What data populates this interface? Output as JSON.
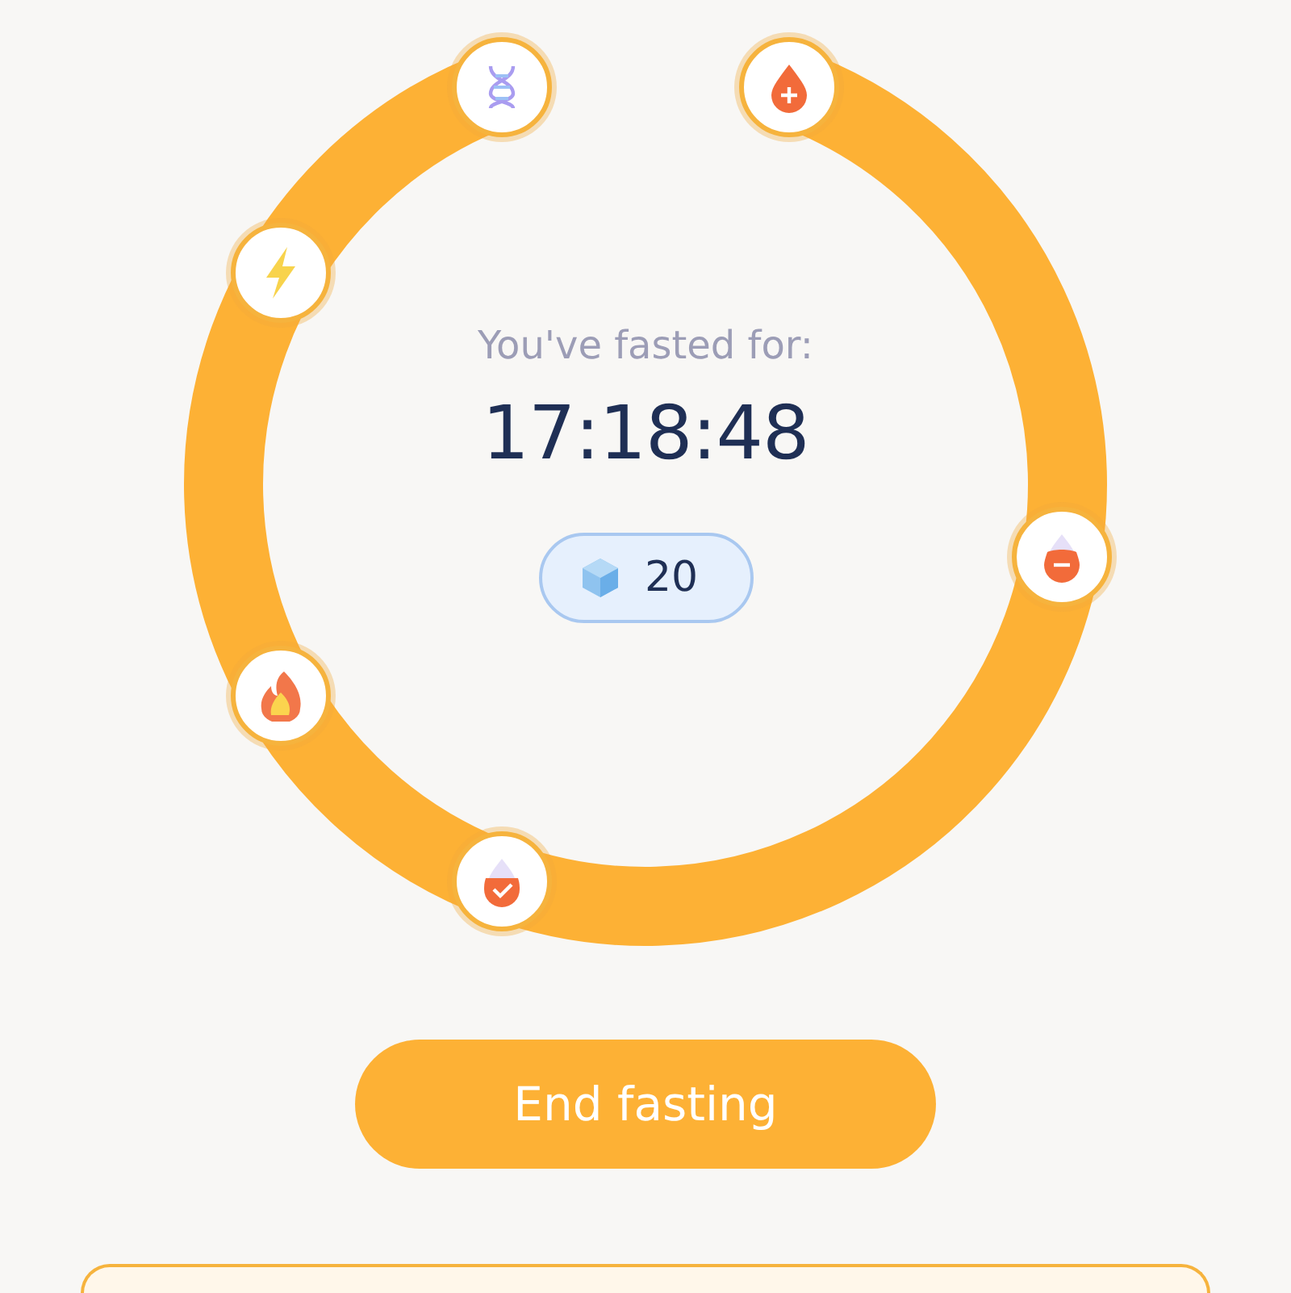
{
  "progress_ring": {
    "caption": "You've fasted for:",
    "elapsed": "17:18:48",
    "badge": {
      "count": "20"
    }
  },
  "end_button": {
    "label": "End fasting"
  }
}
